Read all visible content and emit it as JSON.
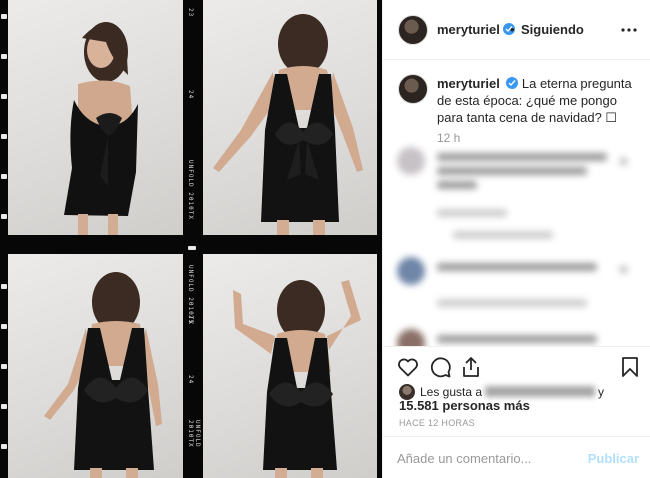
{
  "post": {
    "username": "meryturiel",
    "follow_status": "Siguiendo",
    "dot": "•",
    "caption_user": "meryturiel",
    "caption_text": "La eterna pregunta de esta época: ¿qué me pongo para tanta cena de navidad? ☐",
    "caption_time": "12 h",
    "likes_prefix": "Les gusta a",
    "likes_suffix": "y",
    "likes_count": "15.581 personas más",
    "time_ago": "HACE 12 HORAS",
    "comment_placeholder": "Añade un comentario...",
    "publish_label": "Publicar"
  },
  "photo": {
    "film_markings": [
      "UNFOLD 2010TX",
      "23",
      "24",
      "25",
      "UNFOLD 2010TX",
      "UNFOLD 2010TX"
    ]
  },
  "icons": {
    "more": "more-options-icon",
    "verified": "verified-badge-icon",
    "like": "heart-icon",
    "comment": "comment-bubble-icon",
    "share": "share-icon",
    "save": "bookmark-icon"
  },
  "colors": {
    "verified_blue": "#3897f0",
    "publish_disabled": "#b2dffc",
    "meta_gray": "#999999",
    "border": "#efefef"
  }
}
